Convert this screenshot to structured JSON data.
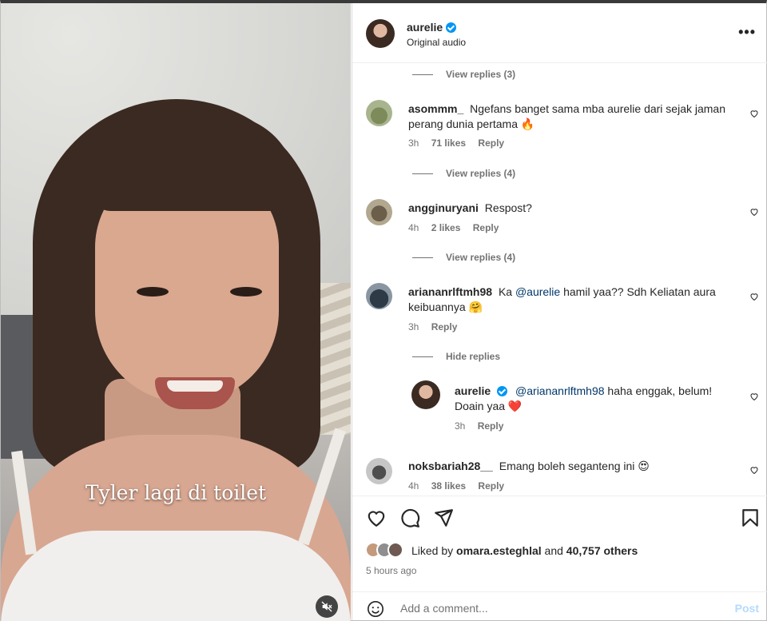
{
  "video": {
    "caption": "Tyler lagi di toilet",
    "mute_icon": "speaker-muted-icon"
  },
  "header": {
    "username": "aurelie",
    "verified": true,
    "subtitle": "Original audio",
    "more_icon": "more-horizontal-icon",
    "more_label": "•••"
  },
  "comments": [
    {
      "type": "view_replies",
      "label": "View replies (3)"
    },
    {
      "type": "comment",
      "username": "asommm_",
      "text_line1": "Ngefans banget sama mba aurelie dari sejak jaman",
      "text_line2": "perang dunia pertama 🔥",
      "time": "3h",
      "likes": "71 likes",
      "reply": "Reply"
    },
    {
      "type": "view_replies",
      "label": "View replies (4)"
    },
    {
      "type": "comment",
      "username": "angginuryani",
      "text_line1": "Respost?",
      "time": "4h",
      "likes": "2 likes",
      "reply": "Reply"
    },
    {
      "type": "view_replies",
      "label": "View replies (4)"
    },
    {
      "type": "comment",
      "username": "ariananrlftmh98",
      "text_pre": "Ka",
      "mention": "@aurelie",
      "text_post": "hamil yaa?? Sdh Keliatan aura",
      "text_line2": "keibuannya 🤗",
      "time": "3h",
      "reply": "Reply"
    },
    {
      "type": "hide_replies",
      "label": "Hide replies"
    },
    {
      "type": "reply",
      "username": "aurelie",
      "verified": true,
      "mention": "@ariananrlftmh98",
      "text_post": "haha enggak, belum!",
      "text_line2": "Doain yaa ❤️",
      "time": "3h",
      "reply": "Reply"
    },
    {
      "type": "comment",
      "username": "noksbariah28__",
      "text_line1": "Emang boleh seganteng ini 😍",
      "time": "4h",
      "likes": "38 likes",
      "reply": "Reply"
    }
  ],
  "actions": {
    "like_icon": "heart-icon",
    "comment_icon": "comment-bubble-icon",
    "share_icon": "send-icon",
    "save_icon": "bookmark-icon"
  },
  "likes": {
    "prefix": "Liked by",
    "user": "omara.esteghlal",
    "and": "and",
    "count": "40,757 others"
  },
  "posted_time": "5 hours ago",
  "add_comment": {
    "placeholder": "Add a comment...",
    "post_label": "Post",
    "emoji_icon": "emoji-smile-icon"
  },
  "colors": {
    "accent": "#0095f6",
    "muted_text": "#737373",
    "post_disabled": "#b3dbff",
    "mention": "#00376b",
    "heart_red": "#ed4956"
  }
}
